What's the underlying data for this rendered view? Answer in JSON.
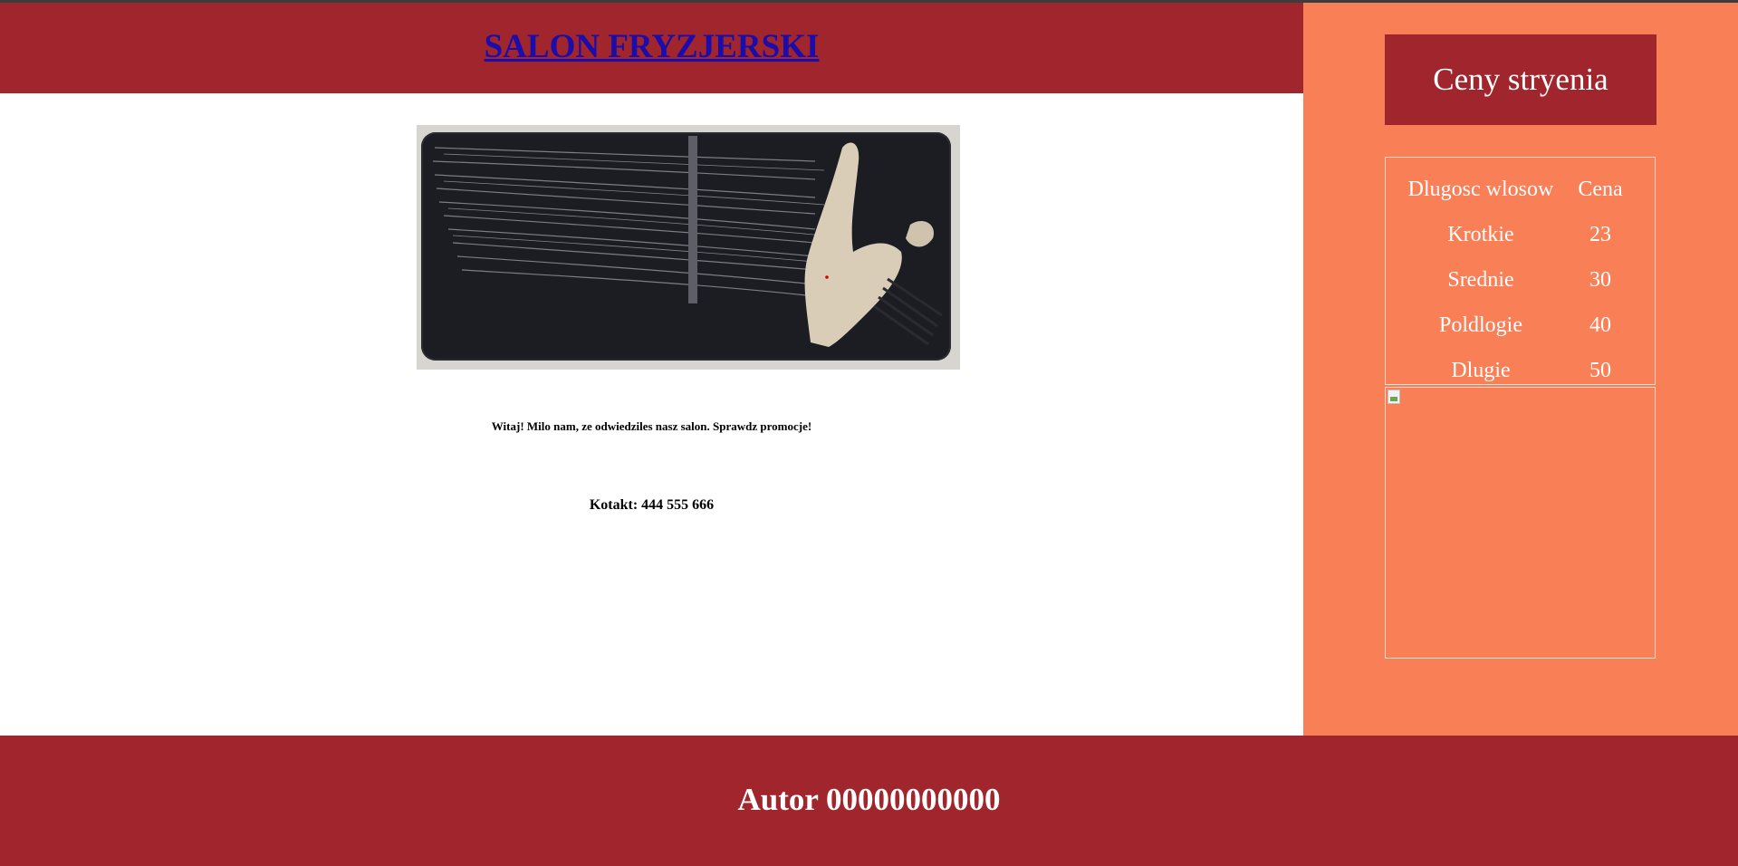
{
  "header": {
    "title": "SALON FRYZJERSKI"
  },
  "main": {
    "welcome_text": "Witaj! Milo nam, ze odwiedziles nasz salon. Sprawdz promocje!",
    "contact_text": "Kotakt: 444 555 666"
  },
  "sidebar": {
    "heading": "Ceny stryenia",
    "table": {
      "headers": [
        "Dlugosc wlosow",
        "Cena"
      ],
      "rows": [
        [
          "Krotkie",
          "23"
        ],
        [
          "Srednie",
          "30"
        ],
        [
          "Poldlogie",
          "40"
        ],
        [
          "Dlugie",
          "50"
        ]
      ]
    }
  },
  "footer": {
    "text": "Autor 00000000000"
  },
  "colors": {
    "header_bg": "#a0252c",
    "sidebar_bg": "#f97f56",
    "link": "#1a0dab"
  }
}
